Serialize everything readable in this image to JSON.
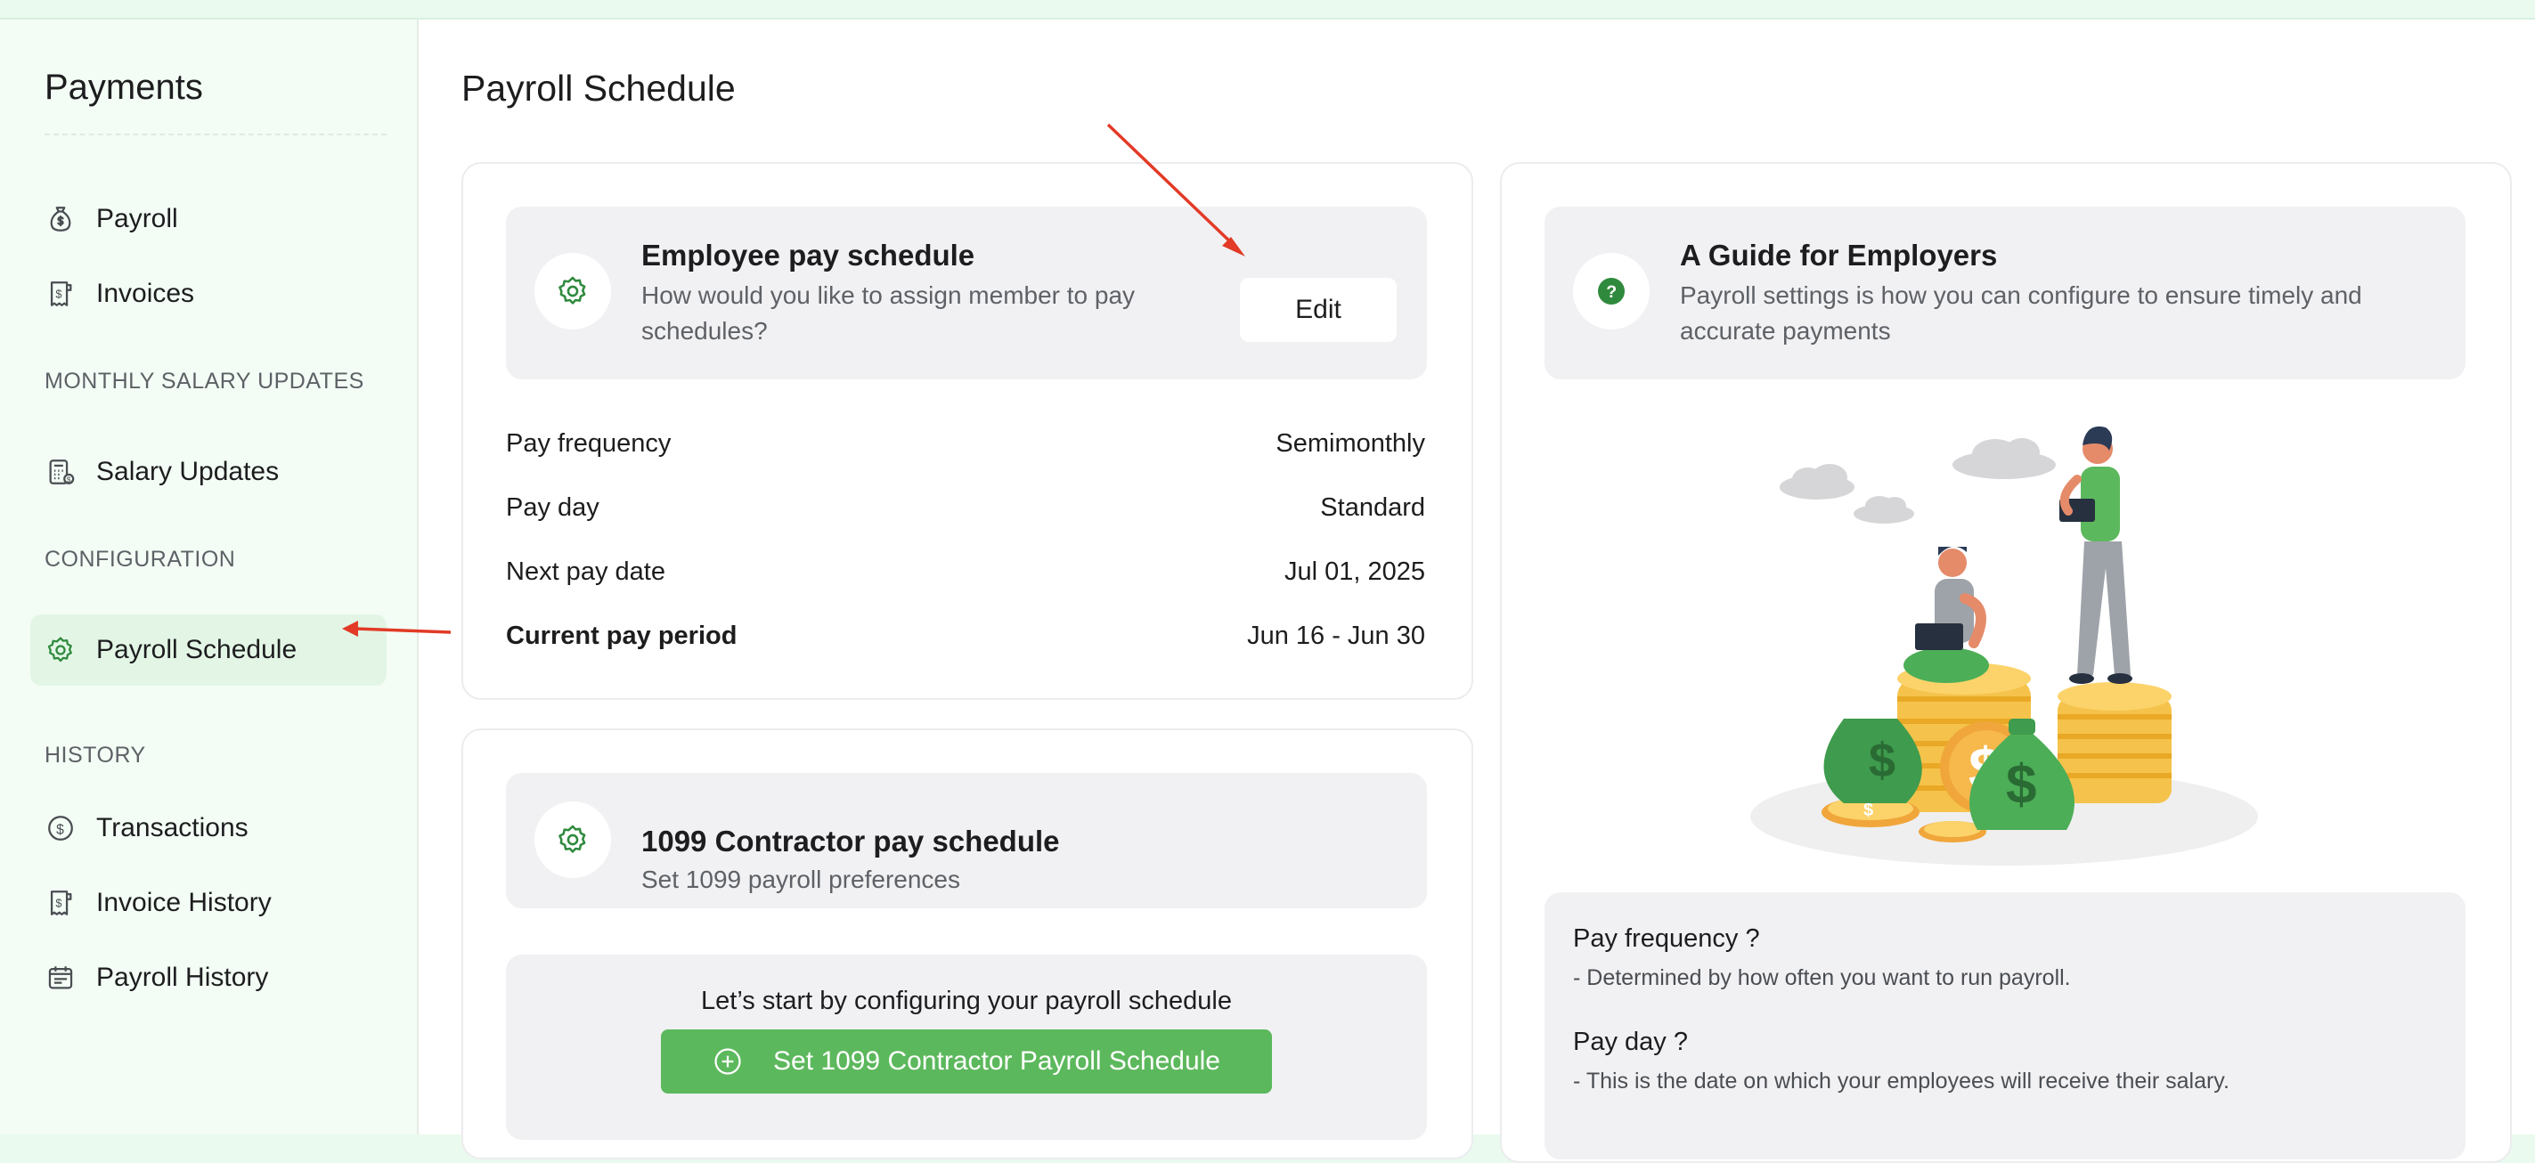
{
  "sidebar": {
    "title": "Payments",
    "items_top": [
      {
        "label": "Payroll",
        "icon": "money-bag-icon"
      },
      {
        "label": "Invoices",
        "icon": "invoice-icon"
      }
    ],
    "section_monthly": "MONTHLY SALARY UPDATES",
    "salary_updates": {
      "label": "Salary Updates",
      "icon": "calculator-icon"
    },
    "section_config": "CONFIGURATION",
    "payroll_schedule": {
      "label": "Payroll Schedule",
      "icon": "gear-icon",
      "active": true
    },
    "section_history": "HISTORY",
    "history_items": [
      {
        "label": "Transactions",
        "icon": "dollar-circle-icon"
      },
      {
        "label": "Invoice History",
        "icon": "invoice-icon"
      },
      {
        "label": "Payroll History",
        "icon": "calendar-list-icon"
      }
    ]
  },
  "main": {
    "title": "Payroll Schedule",
    "employee_card": {
      "heading": "Employee pay schedule",
      "subtext_line1": "How would you like to assign member to pay",
      "subtext_line2": "schedules?",
      "edit_label": "Edit",
      "rows": [
        {
          "label": "Pay frequency",
          "value": "Semimonthly"
        },
        {
          "label": "Pay day",
          "value": "Standard"
        },
        {
          "label": "Next pay date",
          "value": "Jul 01, 2025"
        },
        {
          "label": "Current pay period",
          "value": "Jun 16 - Jun 30"
        }
      ]
    },
    "contractor_card": {
      "heading": "1099 Contractor pay schedule",
      "subtext": "Set 1099 payroll preferences",
      "prompt": "Let’s start by configuring your payroll schedule",
      "button_label": "Set 1099 Contractor Payroll Schedule"
    },
    "guide_card": {
      "heading": "A Guide for Employers",
      "subtext_line1": "Payroll settings is how you can configure to ensure timely and",
      "subtext_line2": "accurate payments",
      "faq": [
        {
          "q": "Pay frequency ?",
          "a": "- Determined by how often you want to run payroll."
        },
        {
          "q": "Pay day ?",
          "a": "- This is the date on which your employees will receive their salary."
        }
      ]
    }
  },
  "colors": {
    "accent_green": "#5cb85c",
    "icon_green": "#2f8a3d",
    "sidebar_bg": "#f3fdf5",
    "active_bg": "#e3f6e6",
    "annotation_red": "#e23a26"
  }
}
